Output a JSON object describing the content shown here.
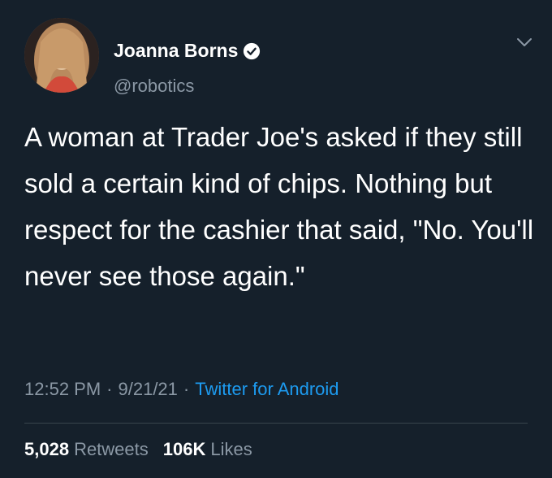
{
  "author": {
    "display_name": "Joanna Borns",
    "handle": "@robotics",
    "verified": true
  },
  "tweet": {
    "text": "A woman at Trader Joe's asked if they still sold a certain kind of chips. Nothing but respect for the cashier that said, \"No. You'll never see those again.\"",
    "time": "12:52 PM",
    "date": "9/21/21",
    "source": "Twitter for Android",
    "separator": "·"
  },
  "stats": {
    "retweets_count": "5,028",
    "retweets_label": "Retweets",
    "likes_count": "106K",
    "likes_label": "Likes"
  },
  "colors": {
    "background": "#15202b",
    "accent": "#1d9bf0",
    "muted": "#8b98a5"
  }
}
